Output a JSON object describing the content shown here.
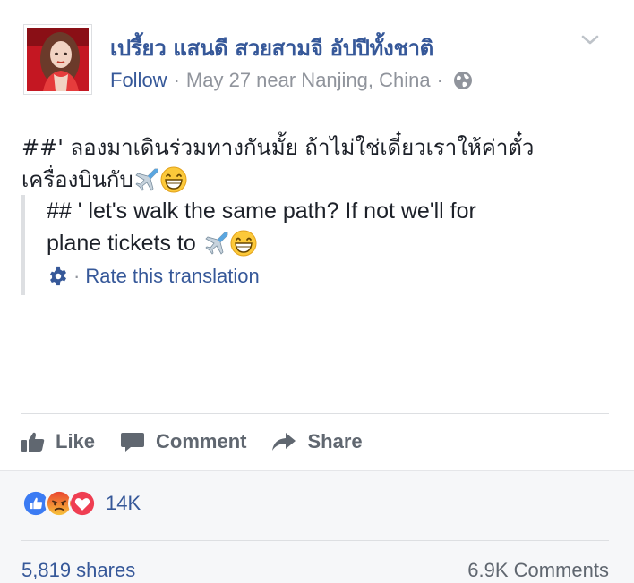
{
  "author": {
    "name": "เปรี้ยว แสนดี สวยสามจี อัปปีทั้งชาติ",
    "follow_label": "Follow",
    "date": "May 27 near Nanjing, China",
    "separator": "·"
  },
  "icons": {
    "chevron": "chevron-down-icon",
    "globe": "globe-icon",
    "airplane": "airplane-emoji",
    "grin": "grinning-emoji",
    "gear": "gear-icon",
    "like": "thumbs-up-icon",
    "comment": "speech-bubble-icon",
    "share": "share-arrow-icon"
  },
  "post": {
    "line1": "##' ลองมาเดินร่วมทางกันมั้ย ถ้าไม่ใช่เดี๋ยวเราให้ค่าตั๋ว",
    "line2": "เครื่องบินกับ"
  },
  "translation": {
    "line1": "## ' let's walk the same path? If not we'll for",
    "line2": "plane tickets to",
    "rate_sep": "·",
    "rate_label": "Rate this translation"
  },
  "actions": {
    "like": "Like",
    "comment": "Comment",
    "share": "Share"
  },
  "feedback": {
    "reaction_count": "14K",
    "shares": "5,819 shares",
    "comments": "6.9K Comments"
  },
  "colors": {
    "link": "#365899",
    "muted": "#90949c",
    "action": "#606770",
    "like_blue": "#3b7bf3",
    "angry": "#f7a74c",
    "love": "#ef3e52"
  }
}
